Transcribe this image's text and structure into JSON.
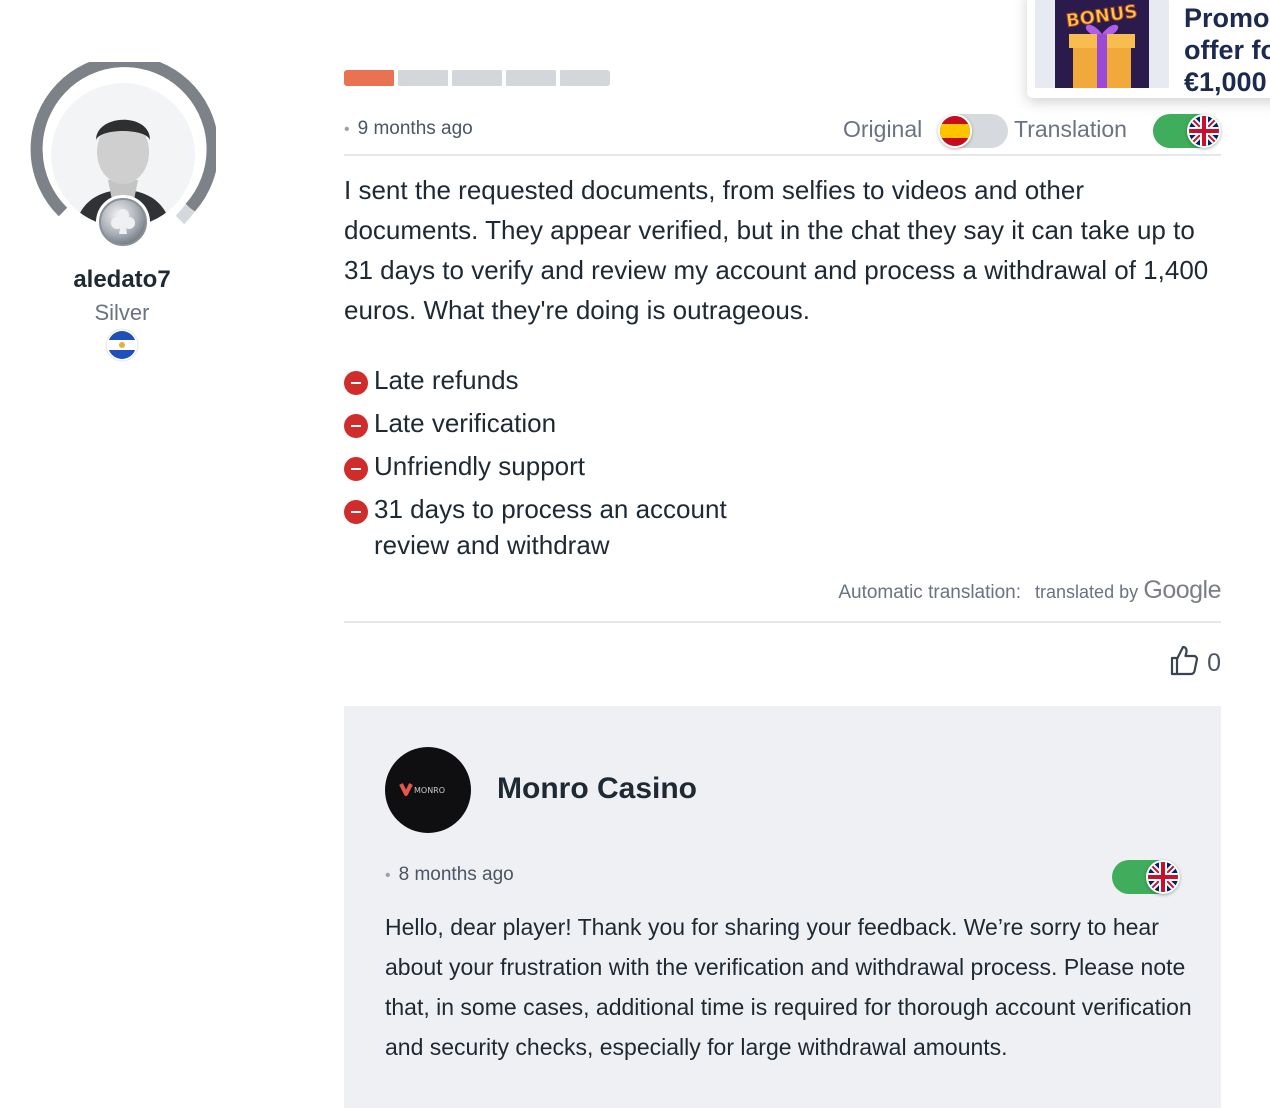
{
  "promo": {
    "image_text": "BONUS",
    "title": "Promo\noffer fo\n€1,000"
  },
  "user": {
    "name": "aledato7",
    "level": "Silver",
    "badge_icon": "club-icon",
    "country_flag_icon": "flag-el-salvador-icon"
  },
  "review": {
    "rating_filled": 1,
    "rating_total": 5,
    "date": "9 months ago",
    "original_label": "Original",
    "translation_label": "Translation",
    "original_flag_icon": "flag-spain-icon",
    "translation_flag_icon": "flag-uk-icon",
    "text": "I sent the requested documents, from selfies to videos and other documents. They appear verified, but in the chat they say it can take up to 31 days to verify and review my account and process a withdrawal of 1,400 euros. What they're doing is outrageous.",
    "cons": [
      "Late refunds",
      "Late verification",
      "Unfriendly support",
      "31 days to process an account review and withdraw"
    ],
    "auto_translation_label": "Automatic translation:",
    "translated_by": "translated by",
    "translator": "Google",
    "likes": "0"
  },
  "reply": {
    "logo_text": "MONRO",
    "casino_name": "Monro Casino",
    "date": "8 months ago",
    "flag_icon": "flag-uk-icon",
    "text": "Hello, dear player! Thank you for sharing your feedback. We’re sorry to hear about your frustration with the verification and withdrawal process. Please note that, in some cases, additional time is required for thorough account verification and security checks, especially for large withdrawal amounts."
  },
  "colors": {
    "rating_on": "#e87252",
    "rating_off": "#d3d7dc",
    "toggle_on": "#3fad5b",
    "con_icon": "#d12c2c",
    "reply_bg": "#eef0f3"
  }
}
